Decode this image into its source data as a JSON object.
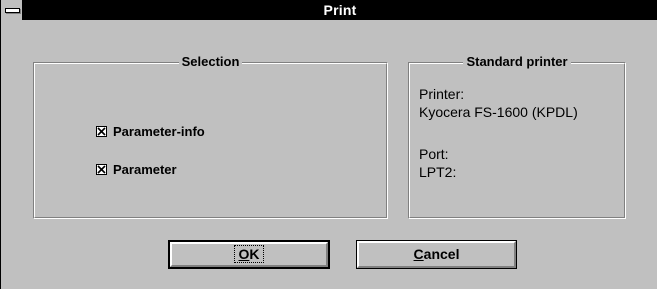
{
  "window": {
    "title": "Print"
  },
  "selection": {
    "title": "Selection",
    "options": [
      {
        "label": "Parameter-info",
        "checked": true
      },
      {
        "label": "Parameter",
        "checked": true
      }
    ]
  },
  "printer": {
    "title": "Standard printer",
    "printer_label": "Printer:",
    "printer_value": "Kyocera FS-1600 (KPDL)",
    "port_label": "Port:",
    "port_value": "LPT2:"
  },
  "buttons": {
    "ok_mnemonic": "O",
    "ok_rest": "K",
    "cancel_mnemonic": "C",
    "cancel_rest": "ancel"
  },
  "colors": {
    "face": "#c0c0c0",
    "titlebar": "#000000",
    "highlight": "#ffffff",
    "shadow": "#808080"
  },
  "icons": {
    "system_menu": "system-menu-icon",
    "check": "check-x-icon"
  }
}
